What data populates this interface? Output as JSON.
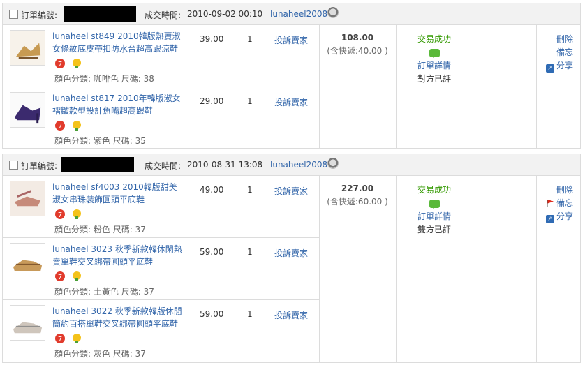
{
  "labels": {
    "order_no": "訂單編號:",
    "deal_time": "成交時間:",
    "attr_prefix_color": "顏色分類:",
    "attr_prefix_size": "尺碼:",
    "complain": "投訴賣家",
    "delete": "刪除",
    "memo": "備忘",
    "share": "分享",
    "status_success": "交易成功",
    "order_detail": "訂單詳情"
  },
  "orders": [
    {
      "deal_time": "2010-09-02 00:10",
      "seller": "lunaheel2008",
      "total": "108.00",
      "shipping": "(含快遞:40.00 )",
      "rating": "對方已評",
      "items": [
        {
          "title": "lunaheel st849 2010韓版熱賣淑女條紋底皮帶扣防水台超高跟涼鞋",
          "price": "39.00",
          "qty": "1",
          "color": "咖啡色",
          "size": "38"
        },
        {
          "title": "lunaheel st817 2010年韓版淑女褶皺款型設計魚嘴超高跟鞋",
          "price": "29.00",
          "qty": "1",
          "color": "紫色",
          "size": "35"
        }
      ]
    },
    {
      "deal_time": "2010-08-31 13:08",
      "seller": "lunaheel2008",
      "total": "227.00",
      "shipping": "(含快遞:60.00 )",
      "rating": "雙方已評",
      "items": [
        {
          "title": "lunaheel sf4003 2010韓版甜美淑女串珠裝飾圓頭平底鞋",
          "price": "49.00",
          "qty": "1",
          "color": "粉色",
          "size": "37"
        },
        {
          "title": "lunaheel 3023 秋季新款韓休閑熱賣單鞋交叉綁帶圓頭平底鞋",
          "price": "59.00",
          "qty": "1",
          "color": "土黃色",
          "size": "37"
        },
        {
          "title": "lunaheel 3022 秋季新款韓版休閒簡約百搭單鞋交叉綁帶圓頭平底鞋",
          "price": "59.00",
          "qty": "1",
          "color": "灰色",
          "size": "37"
        }
      ]
    }
  ]
}
